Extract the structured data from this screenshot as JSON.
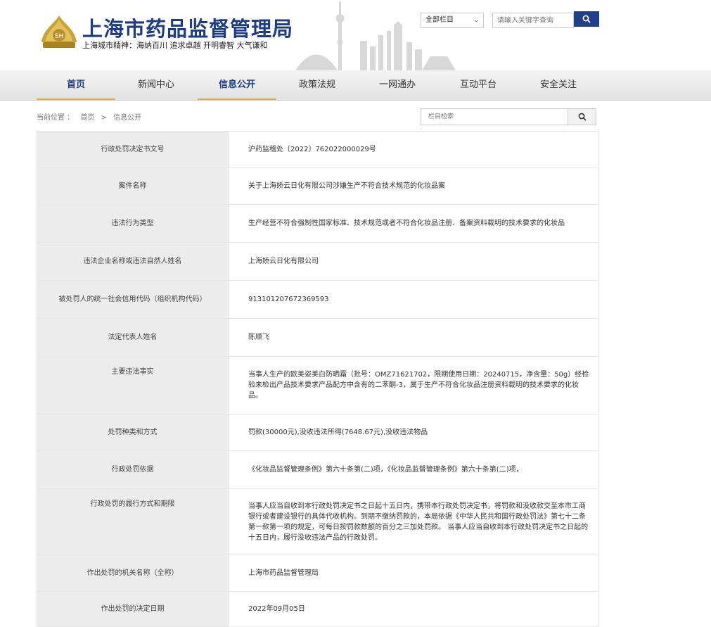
{
  "header": {
    "site_title": "上海市药品监督管理局",
    "slogan": "上海城市精神：海纳百川 追求卓越 开明睿智 大气谦和",
    "scope_select": "全部栏目",
    "search_placeholder": "请输入关键字查询"
  },
  "nav": {
    "items": [
      {
        "label": "首页"
      },
      {
        "label": "新闻中心"
      },
      {
        "label": "信息公开"
      },
      {
        "label": "政策法规"
      },
      {
        "label": "一网通办"
      },
      {
        "label": "互动平台"
      },
      {
        "label": "安全关注"
      }
    ]
  },
  "breadcrumb": {
    "prefix": "当前位置 ：",
    "home": "首页",
    "separator": ">",
    "current": "信息公开"
  },
  "column_search": {
    "placeholder": "栏目检索"
  },
  "colors": {
    "brand_blue": "#1c3c86",
    "nav_active_underline": "#d9a93b",
    "label_bg": "#ececec",
    "logo_gold": "#c9a33a"
  },
  "record": {
    "rows": [
      {
        "label": "行政处罚决定书文号",
        "value": "沪药监稽处〔2022〕762022000029号"
      },
      {
        "label": "案件名称",
        "value": "关于上海娇云日化有限公司涉嫌生产不符合技术规范的化妆品案"
      },
      {
        "label": "违法行为类型",
        "value": "生产经营不符合强制性国家标准、技术规范或者不符合化妆品注册、备案资料载明的技术要求的化妆品"
      },
      {
        "label": "违法企业名称或违法自然人姓名",
        "value": "上海娇云日化有限公司"
      },
      {
        "label": "被处罚人的统一社会信用代码（组织机构代码）",
        "value": "913101207672369593"
      },
      {
        "label": "法定代表人姓名",
        "value": "陈顺飞"
      },
      {
        "label": "主要违法事实",
        "value": "当事人生产的欧美姿美白防晒霜（批号：OMZ71621702，限期使用日期：20240715，净含量：50g）经检验未检出产品技术要求产品配方中含有的二苯酮-3，属于生产不符合化妆品注册资料载明的技术要求的化妆品。"
      },
      {
        "label": "处罚种类和方式",
        "value": "罚款(30000元),没收违法所得(7648.67元),没收违法物品"
      },
      {
        "label": "行政处罚依据",
        "value": "《化妆品监督管理条例》第六十条第(二)项，《化妆品监督管理条例》第六十条第(二)项，"
      },
      {
        "label": "行政处罚的履行方式和期限",
        "value": "当事人应当自收到本行政处罚决定书之日起十五日内，携带本行政处罚决定书，将罚款和没收款交至本市工商银行或者建设银行的具体代收机构。到期不缴纳罚款的，本局依据《中华人民共和国行政处罚法》第七十二条第一款第一项的规定，可每日按罚款数额的百分之三加处罚款。 当事人应当自收到本行政处罚决定书之日起的十五日内，履行没收违法产品的行政处罚。"
      },
      {
        "label": "作出处罚的机关名称（全称）",
        "value": "上海市药品监督管理局"
      },
      {
        "label": "作出处罚的决定日期",
        "value": "2022年09月05日"
      }
    ]
  }
}
